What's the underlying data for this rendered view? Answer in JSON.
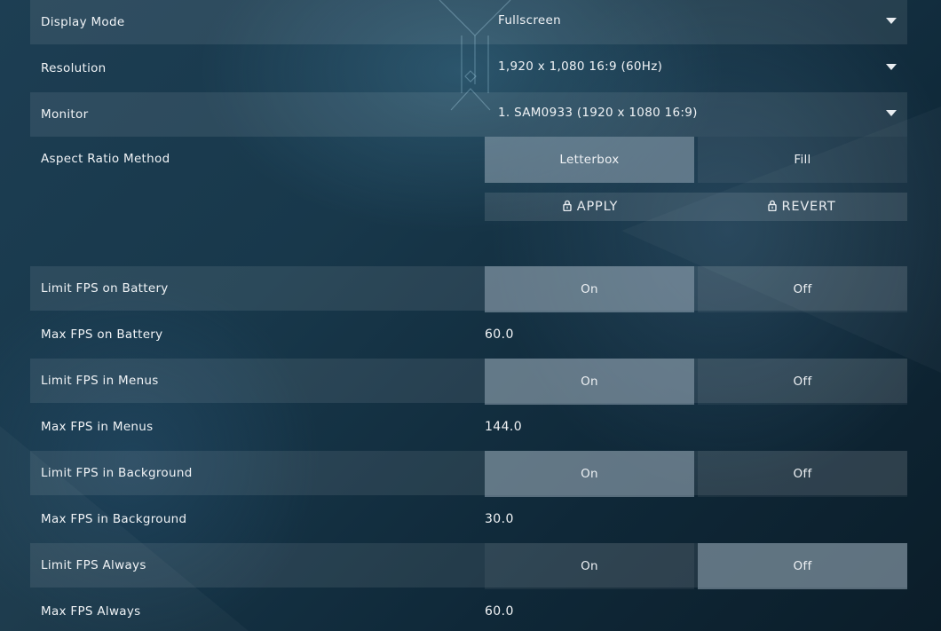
{
  "settings": {
    "display_mode": {
      "label": "Display Mode",
      "value": "Fullscreen"
    },
    "resolution": {
      "label": "Resolution",
      "value": "1,920 x 1,080 16:9 (60Hz)"
    },
    "monitor": {
      "label": "Monitor",
      "value": "1. SAM0933 (1920 x  1080 16:9)"
    },
    "aspect_ratio": {
      "label": "Aspect Ratio Method",
      "option_left": "Letterbox",
      "option_right": "Fill",
      "selected": "Letterbox"
    },
    "actions": {
      "apply": "APPLY",
      "revert": "REVERT"
    },
    "limit_fps_battery": {
      "label": "Limit FPS on Battery",
      "on": "On",
      "off": "Off",
      "selected": "On"
    },
    "max_fps_battery": {
      "label": "Max FPS on Battery",
      "value": "60.0"
    },
    "limit_fps_menus": {
      "label": "Limit FPS in Menus",
      "on": "On",
      "off": "Off",
      "selected": "On"
    },
    "max_fps_menus": {
      "label": "Max FPS in Menus",
      "value": "144.0"
    },
    "limit_fps_background": {
      "label": "Limit FPS in Background",
      "on": "On",
      "off": "Off",
      "selected": "On"
    },
    "max_fps_background": {
      "label": "Max FPS in Background",
      "value": "30.0"
    },
    "limit_fps_always": {
      "label": "Limit FPS Always",
      "on": "On",
      "off": "Off",
      "selected": "Off"
    },
    "max_fps_always": {
      "label": "Max FPS Always",
      "value": "60.0"
    }
  },
  "icons": {
    "dropdown": "chevron-down-icon",
    "lock": "lock-icon"
  },
  "colors": {
    "active_segment": "#7f93a2",
    "row_shade": "#2a4656"
  }
}
